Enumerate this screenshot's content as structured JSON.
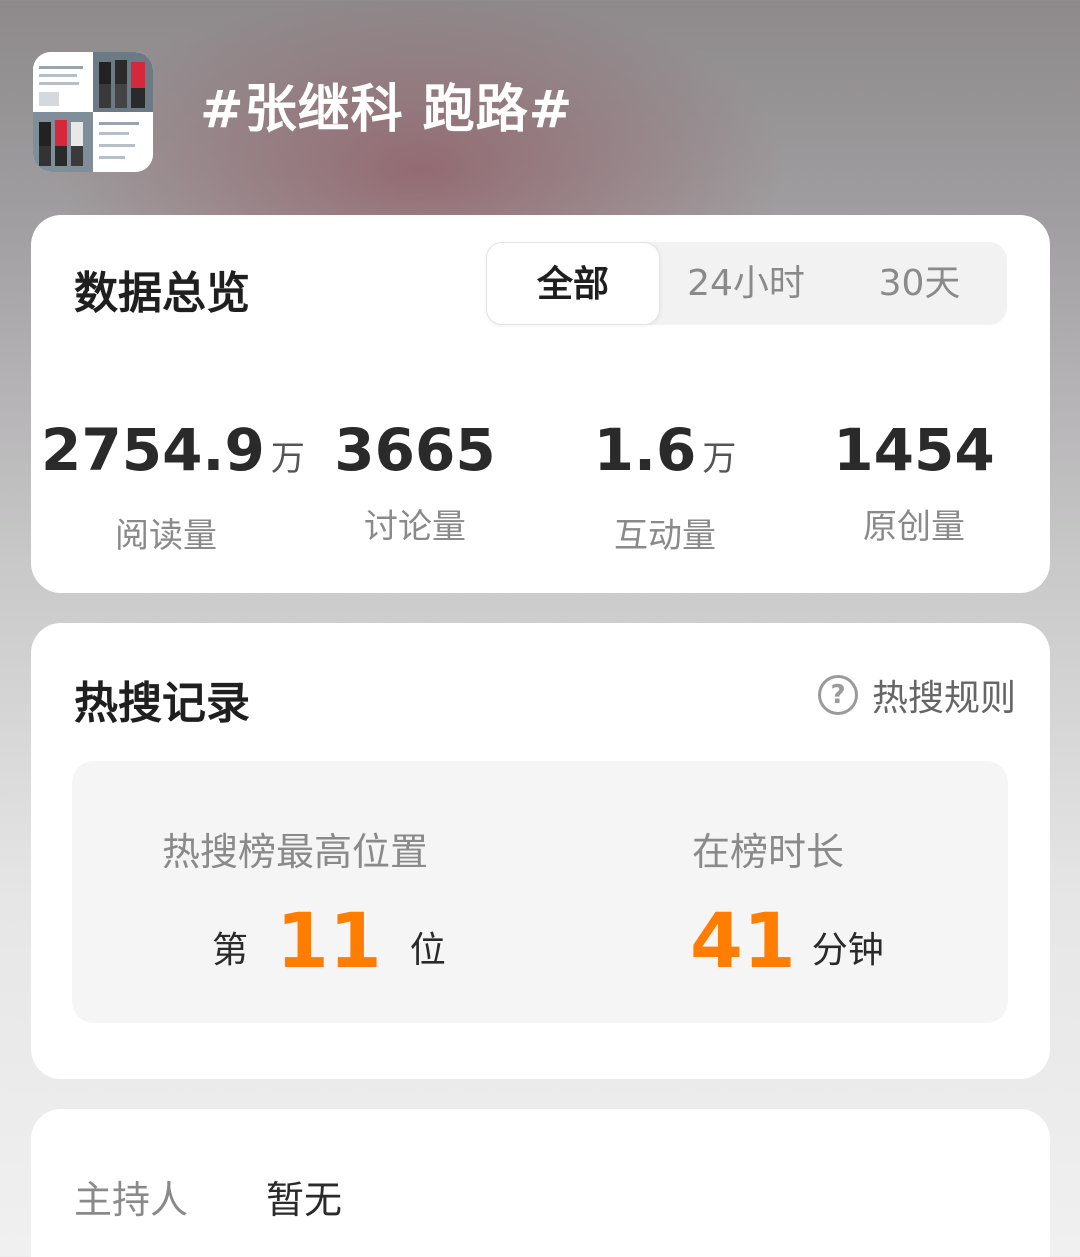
{
  "topic": {
    "title": "#张继科 跑路#",
    "thumbnail": "topic-thumbnail-collage"
  },
  "overview": {
    "title": "数据总览",
    "tabs": [
      {
        "label": "全部",
        "active": true
      },
      {
        "label": "24小时",
        "active": false
      },
      {
        "label": "30天",
        "active": false
      }
    ],
    "stats": [
      {
        "value": "2754.9",
        "unit": "万",
        "label": "阅读量"
      },
      {
        "value": "3665",
        "unit": "",
        "label": "讨论量"
      },
      {
        "value": "1.6",
        "unit": "万",
        "label": "互动量"
      },
      {
        "value": "1454",
        "unit": "",
        "label": "原创量"
      }
    ]
  },
  "hot_search": {
    "title": "热搜记录",
    "rules_label": "热搜规则",
    "rules_icon": "question-circle-icon",
    "peak": {
      "label": "热搜榜最高位置",
      "prefix": "第",
      "value": "11",
      "suffix": "位"
    },
    "duration": {
      "label": "在榜时长",
      "value": "41",
      "suffix": "分钟"
    },
    "accent_color": "#ff7d00"
  },
  "host": {
    "label": "主持人",
    "value": "暂无"
  }
}
